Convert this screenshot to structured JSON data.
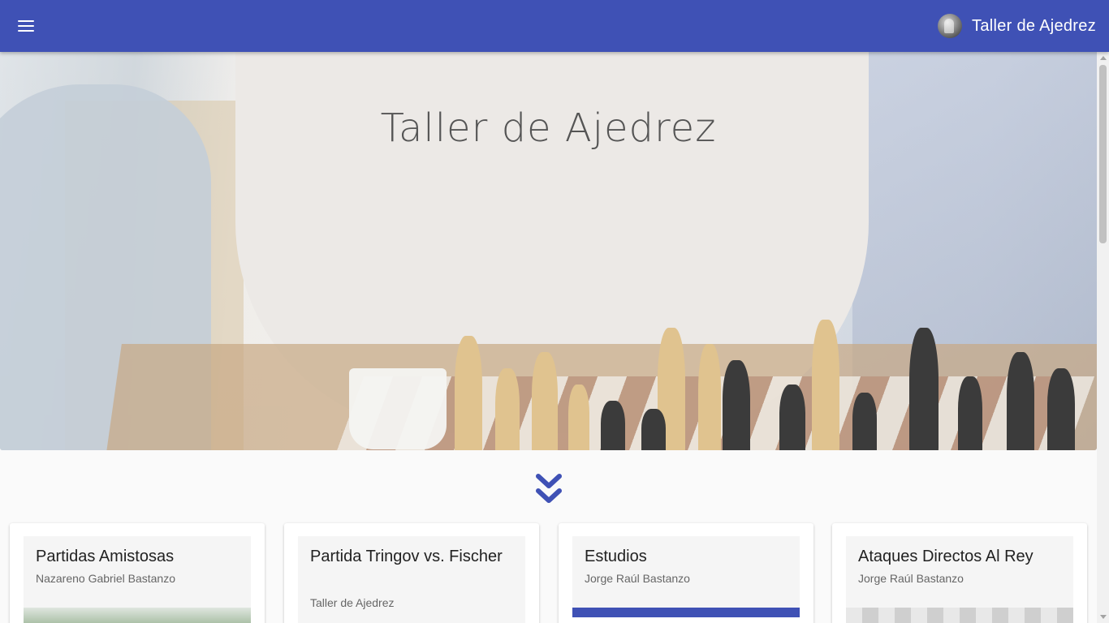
{
  "app_bar": {
    "menu_icon": "hamburger-menu-icon",
    "brand_title": "Taller de Ajedrez",
    "brand_avatar_icon": "chess-pawn-avatar-icon",
    "color": "#3f51b5"
  },
  "hero": {
    "title": "Taller de Ajedrez",
    "scroll_icon": "double-chevron-down-icon"
  },
  "cards": [
    {
      "title": "Partidas Amistosas",
      "subtitle": "Nazareno Gabriel Bastanzo"
    },
    {
      "title": "Partida Tringov vs. Fischer",
      "subtitle": "Taller de Ajedrez"
    },
    {
      "title": "Estudios",
      "subtitle": "Jorge Raúl Bastanzo"
    },
    {
      "title": "Ataques Directos Al Rey",
      "subtitle": "Jorge Raúl Bastanzo"
    }
  ]
}
